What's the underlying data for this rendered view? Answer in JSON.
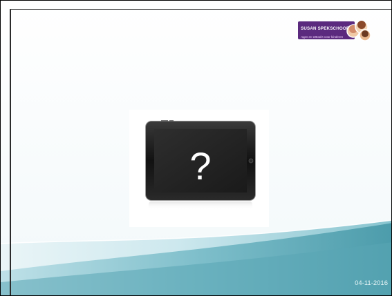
{
  "logo": {
    "title": "SUSAN SPEKSCHOOR",
    "subtitle": "Apps en eBooks voor kinderen"
  },
  "content": {
    "placeholder_symbol": "?"
  },
  "footer": {
    "date": "04-11-2016"
  },
  "colors": {
    "slide_background": "#ffffff",
    "wave_light": "#dff0f3",
    "wave_dark": "#5aa6b4",
    "logo_band": "#5b2a7e"
  }
}
